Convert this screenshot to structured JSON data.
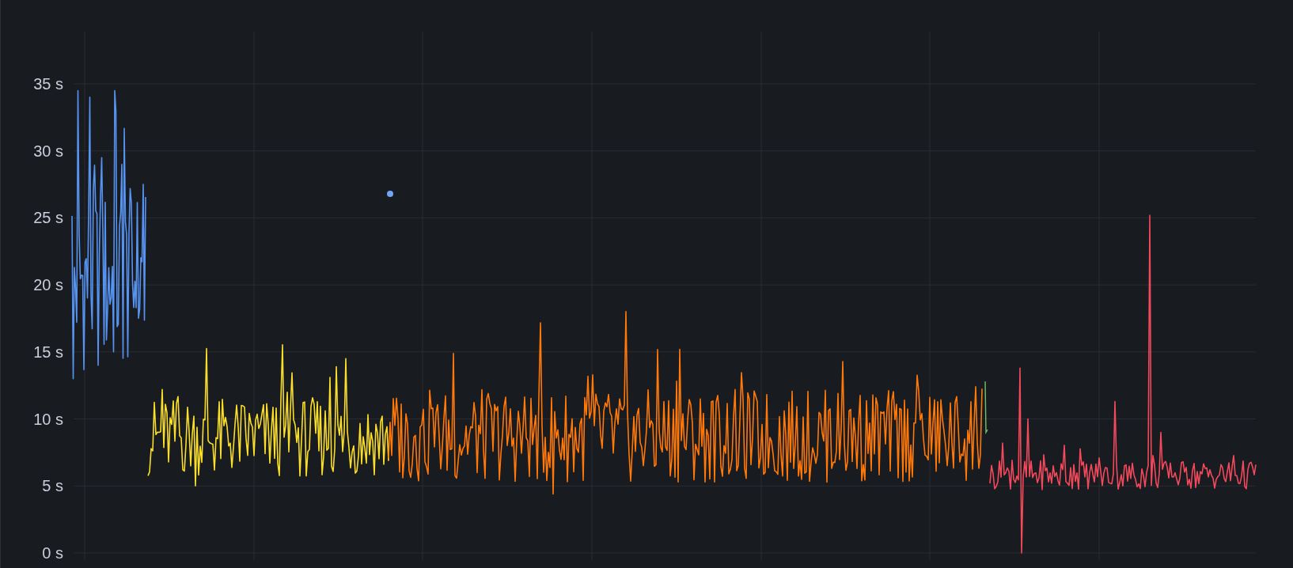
{
  "chart": {
    "y_axis_labels": [
      "35 s",
      "30 s",
      "25 s",
      "20 s",
      "15 s",
      "10 s",
      "5 s",
      "0 s"
    ]
  }
}
